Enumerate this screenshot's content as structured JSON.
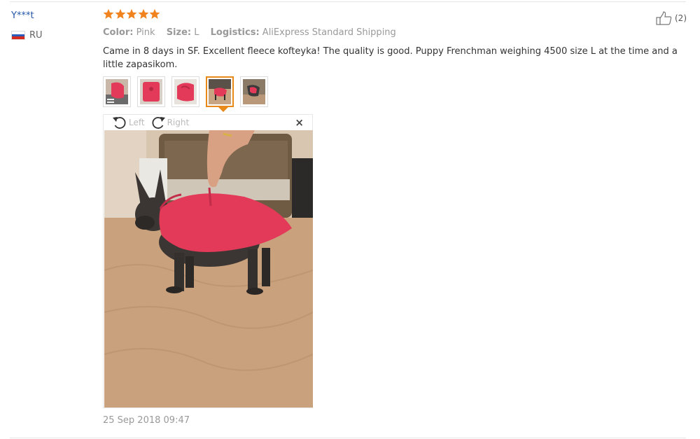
{
  "review": {
    "user": "Y***t",
    "country": "RU",
    "rating": 5,
    "helpful_count": "(2)",
    "meta": {
      "color_label": "Color:",
      "color_value": "Pink",
      "size_label": "Size:",
      "size_value": "L",
      "logistics_label": "Logistics:",
      "logistics_value": "AliExpress Standard Shipping"
    },
    "text": "Came in 8 days in SF. Excellent fleece kofteyka! The quality is good. Puppy Frenchman weighing 4500 size L at the time and a little zapasikom.",
    "thumbnails": [
      {
        "name": "photo-1",
        "active": false
      },
      {
        "name": "photo-2",
        "active": false
      },
      {
        "name": "photo-3",
        "active": false
      },
      {
        "name": "photo-4",
        "active": true
      },
      {
        "name": "photo-5",
        "active": false
      }
    ],
    "viewer": {
      "rotate_left": "Left",
      "rotate_right": "Right",
      "close": "×"
    },
    "date": "25 Sep 2018 09:47"
  },
  "colors": {
    "accent": "#e88a1a",
    "star": "#f0831d",
    "user_link": "#2458a8",
    "sweater": "#e23a58"
  },
  "icons": [
    "star-icon",
    "thumbs-up-icon",
    "rotate-left-icon",
    "rotate-right-icon",
    "close-icon",
    "russia-flag-icon"
  ]
}
